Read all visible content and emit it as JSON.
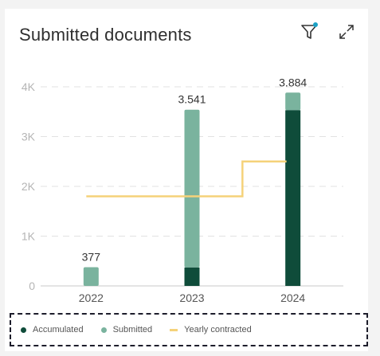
{
  "header": {
    "title": "Submitted documents",
    "filter_icon": "filter-icon",
    "expand_icon": "expand-icon"
  },
  "colors": {
    "accumulated": "#0f4c3a",
    "submitted": "#7ab39e",
    "contracted": "#f5d27a",
    "filter_dot": "#1ba1c5"
  },
  "chart_data": {
    "type": "bar",
    "title": "Submitted documents",
    "categories": [
      "2022",
      "2023",
      "2024"
    ],
    "ylim": [
      0,
      4000
    ],
    "yticks": [
      0,
      1000,
      2000,
      3000,
      4000
    ],
    "ytick_labels": [
      "0",
      "1K",
      "2K",
      "3K",
      "4K"
    ],
    "grid": true,
    "series": [
      {
        "name": "Accumulated",
        "type": "stacked-bar",
        "values": [
          0,
          370,
          3530
        ]
      },
      {
        "name": "Submitted",
        "type": "stacked-bar",
        "values": [
          377,
          3171,
          354
        ]
      },
      {
        "name": "Yearly contracted",
        "type": "step-line",
        "values": [
          1800,
          1800,
          2500
        ]
      }
    ],
    "data_labels": [
      "377",
      "3.541",
      "3.884"
    ],
    "legend_position": "bottom"
  }
}
